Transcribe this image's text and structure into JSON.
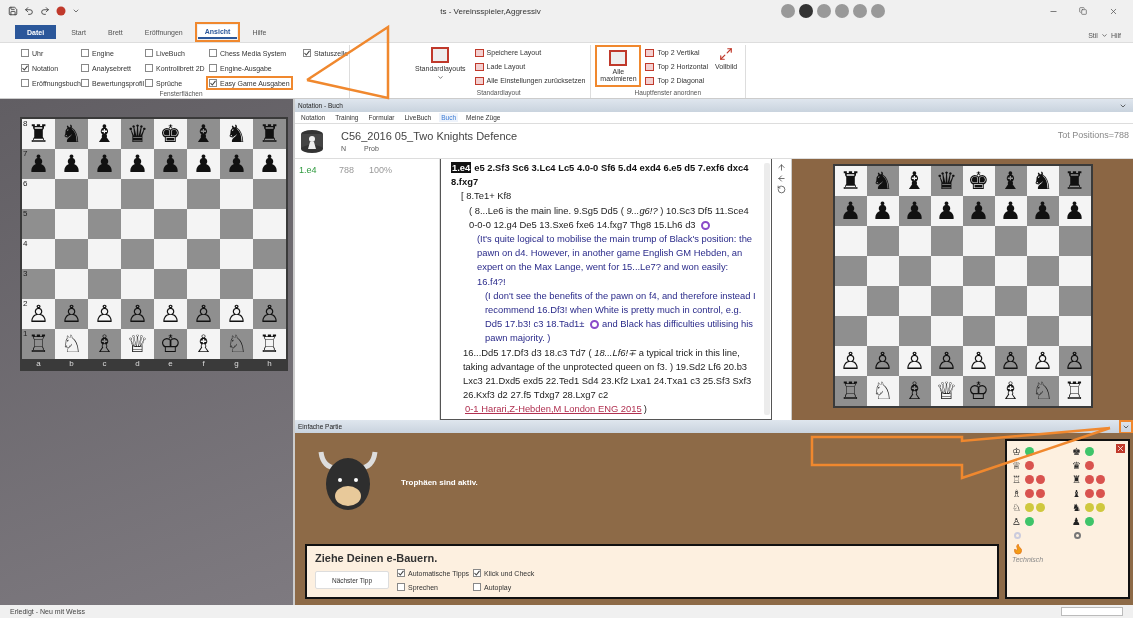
{
  "window": {
    "title": "ts - Vereinsspieler,Aggressiv"
  },
  "ribbon_tabs": [
    {
      "label": "Datei",
      "kind": "file",
      "selected": false,
      "highlighted": false
    },
    {
      "label": "Start",
      "kind": "tab",
      "selected": false,
      "highlighted": false
    },
    {
      "label": "Brett",
      "kind": "tab",
      "selected": false,
      "highlighted": false
    },
    {
      "label": "Eröffnungen",
      "kind": "tab",
      "selected": false,
      "highlighted": false
    },
    {
      "label": "Ansicht",
      "kind": "tab",
      "selected": true,
      "highlighted": true
    },
    {
      "label": "Hilfe",
      "kind": "tab",
      "selected": false,
      "highlighted": false
    }
  ],
  "style_menu": {
    "label": "Stil",
    "help": "Hilf"
  },
  "ribbon": {
    "panes_group": {
      "label": "Fensterflächen",
      "columns": [
        [
          {
            "label": "Uhr",
            "checked": false,
            "highlighted": false
          },
          {
            "label": "Notation",
            "checked": true,
            "highlighted": false
          },
          {
            "label": "Eröffnungsbuch",
            "checked": false,
            "highlighted": false
          }
        ],
        [
          {
            "label": "Engine",
            "checked": false,
            "highlighted": false
          },
          {
            "label": "Analysebrett",
            "checked": false,
            "highlighted": false
          },
          {
            "label": "Bewertungsprofil",
            "checked": false,
            "highlighted": false
          }
        ],
        [
          {
            "label": "LiveBuch",
            "checked": false,
            "highlighted": false
          },
          {
            "label": "Kontrollbrett 2D",
            "checked": false,
            "highlighted": false
          },
          {
            "label": "Sprüche",
            "checked": false,
            "highlighted": false
          }
        ],
        [
          {
            "label": "Chess Media System",
            "checked": false,
            "highlighted": false
          },
          {
            "label": "Engine-Ausgabe",
            "checked": false,
            "highlighted": false
          },
          {
            "label": "Easy Game Ausgaben",
            "checked": true,
            "highlighted": true
          }
        ],
        [
          {
            "label": "Statuszelle",
            "checked": true,
            "highlighted": false
          }
        ]
      ]
    },
    "layout_group": {
      "label": "Standardlayout",
      "big_button": "Standardlayouts",
      "items": [
        "Speichere Layout",
        "Lade Layout",
        "Alle Einstellungen zurücksetzen"
      ]
    },
    "arrange_group": {
      "label": "Hauptfenster anordnen",
      "big_button": "Alle maximieren",
      "big_button_highlighted": true,
      "items": [
        "Top 2 Vertikal",
        "Top 2 Horizontal",
        "Top 2 Diagonal"
      ],
      "fullscreen": "Vollbild"
    }
  },
  "left_board": {
    "ranks": [
      {
        "label": "8",
        "kind": "pieces",
        "pieces": [
          "♜",
          "♞",
          "♝",
          "♛",
          "♚",
          "♝",
          "♞",
          "♜"
        ]
      },
      {
        "label": "7",
        "kind": "pieces",
        "pieces": [
          "♟",
          "♟",
          "♟",
          "♟",
          "♟",
          "♟",
          "♟",
          "♟"
        ]
      },
      {
        "label": "6",
        "kind": "empty"
      },
      {
        "label": "5",
        "kind": "empty"
      },
      {
        "label": "4",
        "kind": "empty"
      },
      {
        "label": "3",
        "kind": "empty"
      },
      {
        "label": "2",
        "kind": "pieces",
        "pieces": [
          "♙",
          "♙",
          "♙",
          "♙",
          "♙",
          "♙",
          "♙",
          "♙"
        ]
      },
      {
        "label": "1",
        "kind": "pieces",
        "pieces": [
          "♖",
          "♘",
          "♗",
          "♕",
          "♔",
          "♗",
          "♘",
          "♖"
        ]
      }
    ],
    "file_labels": [
      "a",
      "b",
      "c",
      "d",
      "e",
      "f",
      "g",
      "h"
    ]
  },
  "notation_panel": {
    "title": "Notation - Buch",
    "tabs": [
      {
        "label": "Notation",
        "selected": false
      },
      {
        "label": "Training",
        "selected": false
      },
      {
        "label": "Formular",
        "selected": false
      },
      {
        "label": "LiveBuch",
        "selected": false
      },
      {
        "label": "Buch",
        "selected": true
      },
      {
        "label": "Meine Züge",
        "selected": false
      }
    ],
    "book": {
      "title": "C56_2016 05_Two Knights Defence",
      "columns": [
        "N",
        "Prob"
      ],
      "total": "Tot Positions=788",
      "rows": [
        {
          "move": "1.e4",
          "n": "788",
          "prob": "100%"
        }
      ]
    },
    "paragraphs": [
      {
        "kind": "main",
        "segments": [
          {
            "kind": "current",
            "text": "1.e4"
          },
          {
            "kind": "text",
            "text": "e5 2.Sf3 Sc6 3.Lc4 Lc5 4.0-0 Sf6 5.d4 exd4 6.e5 d5 7.exf6 dxc4 8.fxg7"
          }
        ]
      },
      {
        "kind": "variation",
        "segments": [
          {
            "kind": "text",
            "text": "[ 8.Te1+ Kf8"
          }
        ]
      },
      {
        "kind": "subvariation",
        "segments": [
          {
            "kind": "text",
            "text": "( 8...Le6 is the main line. 9.Sg5 Dd5 ( *9...g6!?* ) 10.Sc3 Df5 11.Sce4 0-0-0 12.g4 De5 13.Sxe6 fxe6 14.fxg7 Thg8 15.Lh6 d3"
          },
          {
            "kind": "marker"
          }
        ]
      },
      {
        "kind": "comment",
        "segments": [
          {
            "kind": "text",
            "text": "(It's quite logical to mobilise the main trump of Black's position: the pawn on d4. However, in another game English GM Hebden, an expert on the Max Lange, went for 15...Le7? and won easily: 16.f4?!"
          }
        ]
      },
      {
        "kind": "subcomment",
        "segments": [
          {
            "kind": "text",
            "text": "(I don't see the benefits of the pawn on f4, and therefore instead I recommend 16.Df3! when White is pretty much in control, e.g. Dd5 17.b3! c3 18.Tad1±"
          },
          {
            "kind": "marker"
          },
          {
            "kind": "text",
            "text": "and Black has difficulties utilising his pawn majority. )"
          }
        ]
      },
      {
        "kind": "line",
        "segments": [
          {
            "kind": "text",
            "text": "16...Dd5 17.Df3 d3 18.c3 Td7 ( *18...Lf6!∓* a typical trick in this line, taking advantage of the unprotected queen on f3. ) 19.Sd2 Lf6 20.b3 Lxc3 21.Dxd5 exd5 22.Ted1 Sd4 23.Kf2 Lxa1 24.Txa1 c3 25.Sf3 Sxf3 26.Kxf3 d2 27.f5 Tdxg7 28.Lxg7 c2"
          },
          {
            "kind": "link",
            "text": "0-1 Harari,Z-Hebden,M London ENG 2015"
          },
          {
            "kind": "text",
            "text": ")"
          }
        ]
      }
    ]
  },
  "right_board": {
    "ranks": [
      {
        "kind": "pieces",
        "pieces": [
          "♜",
          "♞",
          "♝",
          "♛",
          "♚",
          "♝",
          "♞",
          "♜"
        ]
      },
      {
        "kind": "pieces",
        "pieces": [
          "♟",
          "♟",
          "♟",
          "♟",
          "♟",
          "♟",
          "♟",
          "♟"
        ]
      },
      {
        "kind": "empty"
      },
      {
        "kind": "empty"
      },
      {
        "kind": "empty"
      },
      {
        "kind": "empty"
      },
      {
        "kind": "pieces",
        "pieces": [
          "♙",
          "♙",
          "♙",
          "♙",
          "♙",
          "♙",
          "♙",
          "♙"
        ]
      },
      {
        "kind": "pieces",
        "pieces": [
          "♖",
          "♘",
          "♗",
          "♕",
          "♔",
          "♗",
          "♘",
          "♖"
        ]
      }
    ]
  },
  "easy_game": {
    "title": "Einfache Partie",
    "menu_highlighted": true,
    "message": "Trophäen sind aktiv.",
    "task": "Ziehe Deinen e-Bauern.",
    "button": "Nächster Tipp",
    "options": [
      {
        "label": "Automatische Tipps",
        "checked": true
      },
      {
        "label": "Klick und Check",
        "checked": true
      },
      {
        "label": "Sprechen",
        "checked": false
      },
      {
        "label": "Autoplay",
        "checked": false
      }
    ]
  },
  "trophies": {
    "caption": "Technisch",
    "rows": [
      {
        "white_piece": "♔",
        "black_piece": "♚",
        "white_dots": [
          {
            "color": "#3fc46a"
          }
        ],
        "black_dots": [
          {
            "color": "#3fc46a"
          }
        ]
      },
      {
        "white_piece": "♕",
        "black_piece": "♛",
        "white_dots": [
          {
            "color": "#d9534f"
          }
        ],
        "black_dots": [
          {
            "color": "#d9534f"
          }
        ]
      },
      {
        "white_piece": "♖",
        "black_piece": "♜",
        "white_dots": [
          {
            "color": "#d9534f"
          },
          {
            "color": "#d9534f"
          }
        ],
        "black_dots": [
          {
            "color": "#d9534f"
          },
          {
            "color": "#d9534f"
          }
        ]
      },
      {
        "white_piece": "♗",
        "black_piece": "♝",
        "white_dots": [
          {
            "color": "#d9534f"
          },
          {
            "color": "#d9534f"
          }
        ],
        "black_dots": [
          {
            "color": "#d9534f"
          },
          {
            "color": "#d9534f"
          }
        ]
      },
      {
        "white_piece": "♘",
        "black_piece": "♞",
        "white_dots": [
          {
            "color": "#cfc83e"
          },
          {
            "color": "#cfc83e"
          }
        ],
        "black_dots": [
          {
            "color": "#cfc83e"
          },
          {
            "color": "#cfc83e"
          }
        ]
      },
      {
        "white_piece": "♙",
        "black_piece": "♟",
        "white_dots": [
          {
            "color": "#3fc46a"
          }
        ],
        "black_dots": [
          {
            "color": "#3fc46a"
          }
        ]
      }
    ]
  },
  "status_bar": {
    "text": "Erledigt - Neu mit Weiss",
    "progress": {
      "level": 0
    }
  }
}
